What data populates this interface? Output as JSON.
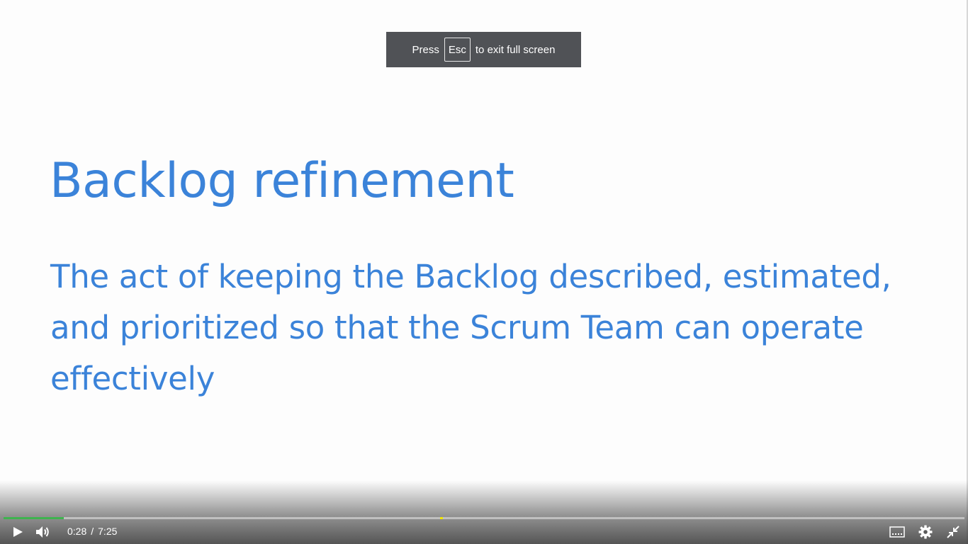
{
  "fullscreen_notice": {
    "prefix": "Press",
    "key": "Esc",
    "suffix": "to exit full screen"
  },
  "slide": {
    "title": "Backlog refinement",
    "body": "The act of keeping the Backlog described, estimated, and prioritized so that the Scrum Team can operate effectively",
    "text_color": "#3b83d9"
  },
  "player": {
    "current_time": "0:28",
    "separator": "/",
    "duration": "7:25",
    "progress_fraction": 0.063,
    "marker_fraction": 0.454,
    "progress_color": "#3fb34f",
    "marker_color": "#f2e600",
    "controls": {
      "play": "play-icon",
      "volume": "volume-icon",
      "captions": "captions-icon",
      "settings": "gear-icon",
      "exit_fullscreen": "exit-fullscreen-icon"
    }
  }
}
